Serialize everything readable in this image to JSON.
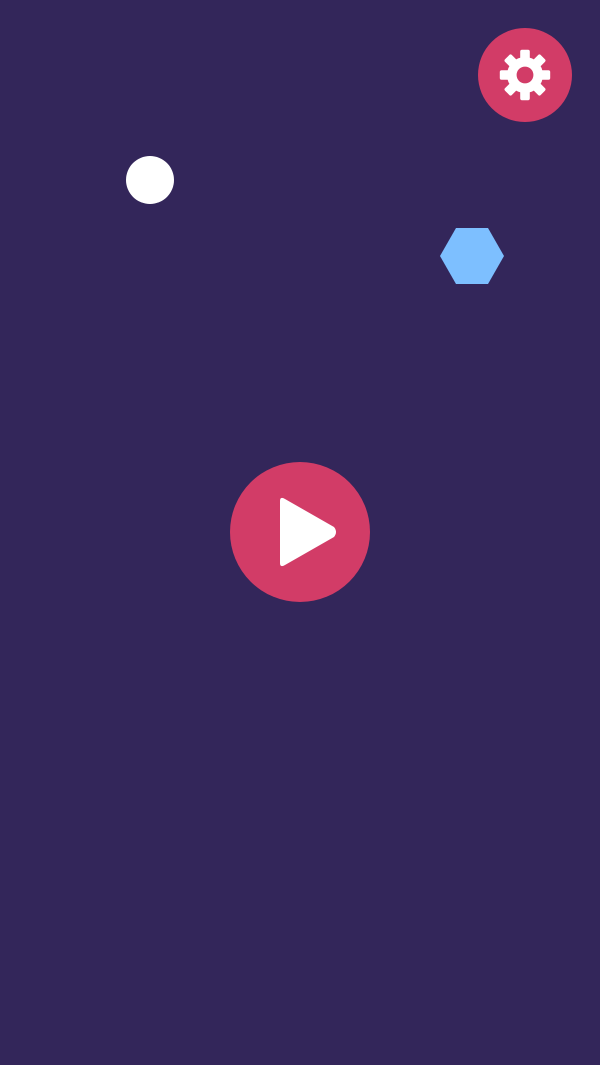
{
  "screen": {
    "background_color": "#33265a"
  },
  "settings_button": {
    "icon": "gear-icon",
    "color": "#d23c67",
    "icon_color": "#ffffff"
  },
  "play_button": {
    "icon": "play-icon",
    "color": "#d23c67",
    "icon_color": "#ffffff"
  },
  "decorations": {
    "white_dot_color": "#ffffff",
    "blue_hexagon_color": "#7dbfff"
  }
}
